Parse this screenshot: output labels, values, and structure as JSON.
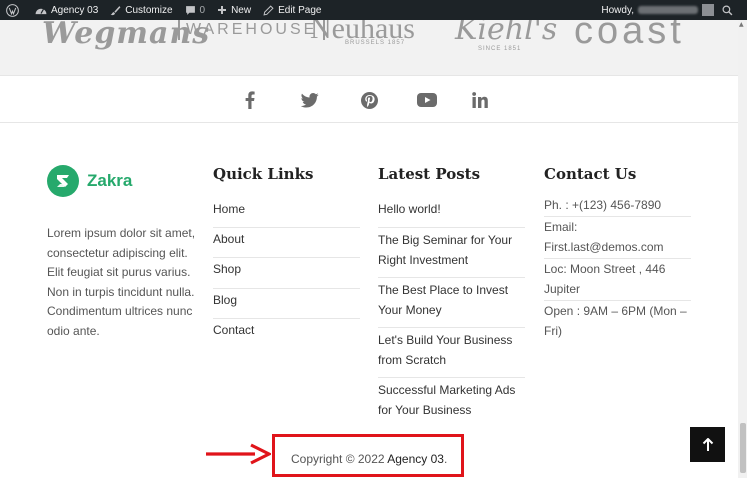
{
  "adminbar": {
    "site_name": "Agency 03",
    "customize": "Customize",
    "comments_count": "0",
    "new": "New",
    "edit_page": "Edit Page",
    "howdy": "Howdy,"
  },
  "logos": {
    "wegmans": "Wegmans",
    "warehouse": "WAREHOUSE",
    "neuhaus": "Neuhaus",
    "neuhaus_sub": "BRUSSELS 1857",
    "kiehls": "Kiehl's",
    "kiehls_sub": "SINCE 1851",
    "coast": "coast"
  },
  "social": {
    "icons": [
      "facebook-icon",
      "twitter-icon",
      "pinterest-icon",
      "youtube-icon",
      "linkedin-icon"
    ],
    "color": "#6b6b6b"
  },
  "footer": {
    "brand_name": "Zakra",
    "brand_color": "#26a96c",
    "about": "Lorem ipsum dolor sit amet, consectetur adipiscing elit. Elit feugiat sit purus varius. Non in turpis tincidunt nulla. Condimentum ultrices nunc odio ante.",
    "quick_links": {
      "title": "Quick Links",
      "items": [
        "Home",
        "About",
        "Shop",
        "Blog",
        "Contact"
      ]
    },
    "latest_posts": {
      "title": "Latest Posts",
      "items": [
        "Hello world!",
        "The Big Seminar for Your Right Investment",
        "The Best Place to Invest Your Money",
        "Let's Build Your Business from Scratch",
        "Successful Marketing Ads for Your Business"
      ]
    },
    "contact": {
      "title": "Contact Us",
      "phone": "Ph. : +(123) 456-7890",
      "email": "Email: First.last@demos.com",
      "location": "Loc: Moon Street , 446 Jupiter",
      "hours": "Open : 9AM – 6PM (Mon – Fri)"
    },
    "copyright_prefix": "Copyright © 2022 ",
    "copyright_link": "Agency 03",
    "copyright_suffix": "."
  },
  "annotation": {
    "color": "#e0141a"
  }
}
